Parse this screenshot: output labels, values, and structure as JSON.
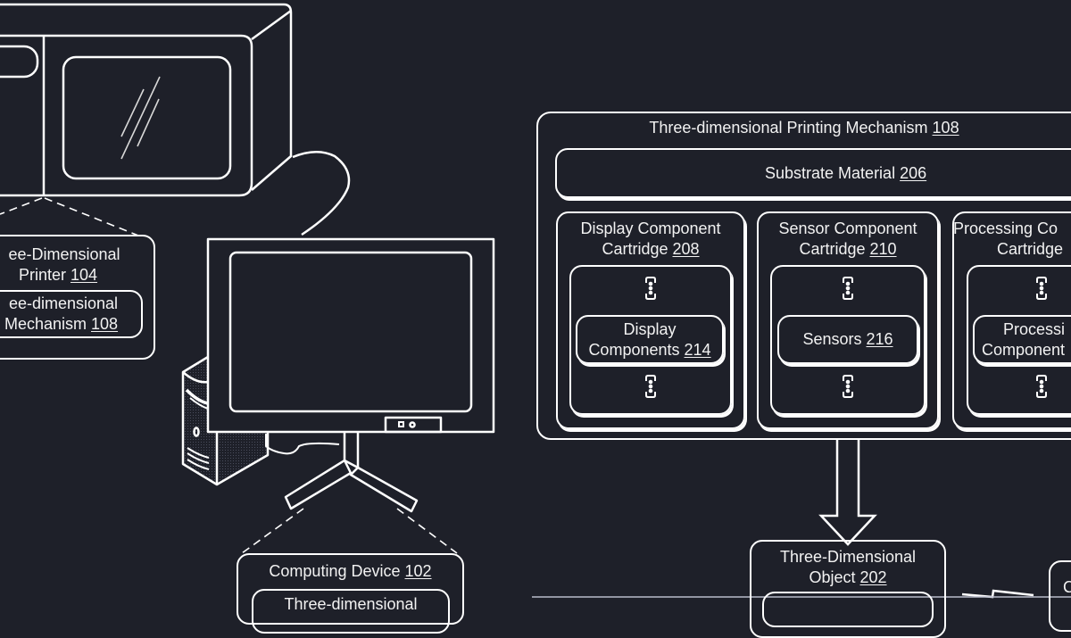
{
  "colors": {
    "background": "#1e2029",
    "stroke": "#ffffff",
    "text": "#f2f2f2"
  },
  "printer_callout": {
    "title": "Three-Dimensional",
    "title_line2": "Printer",
    "ref": "104",
    "visible_title": "ee-Dimensional",
    "visible_title_line2": "Printer",
    "inner": {
      "line1": "ee-dimensional",
      "line2": "g Mechanism",
      "ref": "108"
    }
  },
  "computing_device_callout": {
    "title": "Computing Device",
    "ref": "102",
    "inner_partial": "Three-dimensional"
  },
  "mechanism": {
    "title": "Three-dimensional Printing Mechanism",
    "ref": "108",
    "substrate": {
      "label": "Substrate Material",
      "ref": "206"
    },
    "cartridges": [
      {
        "line1": "Display Component",
        "line2": "Cartridge",
        "ref": "208",
        "component": {
          "line1": "Display",
          "line2": "Components",
          "ref": "214"
        }
      },
      {
        "line1": "Sensor Component",
        "line2": "Cartridge",
        "ref": "210",
        "component": {
          "line1": "",
          "line2": "Sensors",
          "ref": "216"
        }
      },
      {
        "line1": "Processing Co",
        "line2": "Cartridge",
        "ref": "",
        "component": {
          "line1": "Processi",
          "line2": "Component",
          "ref": ""
        }
      }
    ]
  },
  "object_box": {
    "line1": "Three-Dimensional",
    "line2": "Object",
    "ref": "202"
  },
  "partial_right_box": {
    "label": "C"
  },
  "icons": {
    "ellipsis_vertical": "vertical-ellipsis-icon",
    "down_arrow": "down-arrow-icon",
    "lightning": "wireless-link-icon"
  }
}
